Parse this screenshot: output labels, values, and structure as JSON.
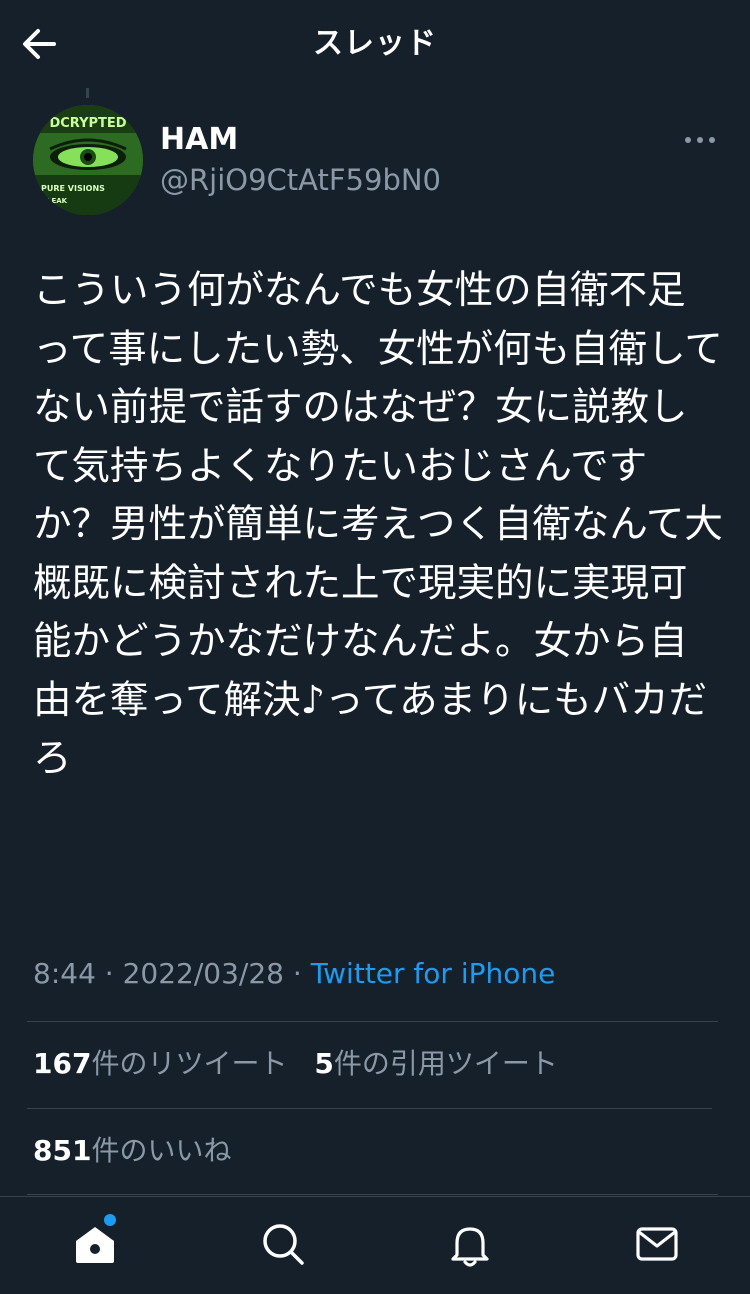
{
  "header": {
    "title": "スレッド",
    "back_icon": "arrow-left-icon"
  },
  "author": {
    "display_name": "HAM",
    "handle": "@RjiO9CtAtF59bN0",
    "avatar_text_top": "DCRYPTED",
    "avatar_text_mid": "PURE VISIONS",
    "avatar_text_low": "LEAK"
  },
  "tweet": {
    "text": "こういう何がなんでも女性の自衛不足って事にしたい勢、女性が何も自衛してない前提で話すのはなぜ？女に説教して気持ちよくなりたいおじさんですか？男性が簡単に考えつく自衛なんて大概既に検討された上で現実的に実現可能かどうかなだけなんだよ。女から自由を奪って解決♪ってあまりにもバカだろ",
    "time": "8:44",
    "separator": " · ",
    "date": "2022/03/28",
    "source": "Twitter for iPhone"
  },
  "stats": {
    "retweets_count": "167",
    "retweets_label": "件のリツイート",
    "quotes_count": "5",
    "quotes_label": "件の引用ツイート",
    "likes_count": "851",
    "likes_label": "件のいいね"
  },
  "tabbar": {
    "items": [
      "home-icon",
      "search-icon",
      "bell-icon",
      "mail-icon"
    ]
  },
  "colors": {
    "background": "#15202b",
    "text": "#ffffff",
    "secondary": "#8b98a5",
    "accent": "#1d9bf0",
    "divider": "#38444d"
  }
}
